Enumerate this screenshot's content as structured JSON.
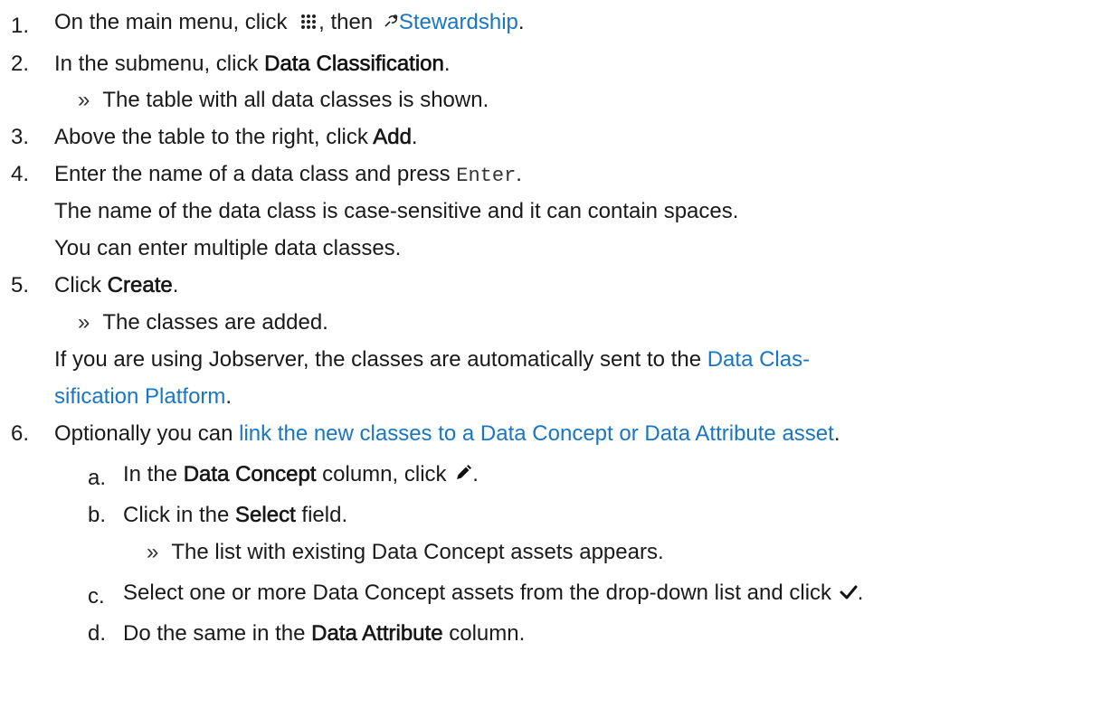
{
  "steps": {
    "s1": {
      "num": "1.",
      "before": "On the main menu, click",
      "mid": ", then",
      "link": "Stewardship",
      "after": ".",
      "icon1": "apps-grid-icon",
      "icon2": "stewardship-icon"
    },
    "s2": {
      "num": "2.",
      "before": "In the submenu, click",
      "bold": "Data Classification",
      "after": ".",
      "result": "The table with all data classes is shown."
    },
    "s3": {
      "num": "3.",
      "before": "Above the table to the right, click",
      "bold": "Add",
      "after": "."
    },
    "s4": {
      "num": "4.",
      "before": "Enter the name of a data class and press",
      "key": "Enter",
      "after": ".",
      "note1": "The name of the data class is case-sensitive and it can contain spaces.",
      "note2": "You can enter multiple data classes."
    },
    "s5": {
      "num": "5.",
      "before": "Click",
      "bold": "Create",
      "after": ".",
      "result": "The classes are added.",
      "note1": "If you are using Jobserver, the classes are automatically sent to the",
      "link1": "Data Clas-",
      "link2": "sification Platform",
      "after2": "."
    },
    "s6": {
      "num": "6.",
      "before": "Optionally you can",
      "link": "link the new classes to a Data Concept or Data Attribute asset",
      "after": "."
    },
    "sa": {
      "num": "a.",
      "before": "In the",
      "bold": "Data Concept",
      "mid": "column, click",
      "after": ".",
      "icon": "pencil-icon"
    },
    "sb": {
      "num": "b.",
      "before": "Click in the",
      "bold": "Select",
      "after": "field.",
      "result": "The list with existing Data Concept assets appears."
    },
    "sc": {
      "num": "c.",
      "text": "Select one or more Data Concept assets from the drop-down list and click",
      "after": ".",
      "icon": "checkmark-icon"
    },
    "sd": {
      "num": "d.",
      "before": "Do the same in the",
      "bold": "Data Attribute",
      "after": "column."
    }
  },
  "result_marker": "»",
  "colors": {
    "link": "#1976c2",
    "text": "#1a1a1a"
  }
}
